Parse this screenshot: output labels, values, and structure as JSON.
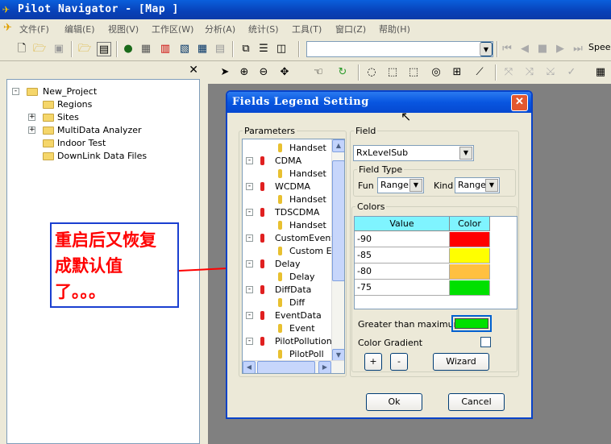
{
  "app": {
    "title": "Pilot Navigator - [Map  ]"
  },
  "menu": [
    "文件(F)",
    "编辑(E)",
    "视图(V)",
    "工作区(W)",
    "分析(A)",
    "统计(S)",
    "工具(T)",
    "窗口(Z)",
    "帮助(H)"
  ],
  "toolbar": {
    "speed_label": "Speed"
  },
  "tree": {
    "items": [
      {
        "label": "New_Project",
        "expander": "-"
      },
      {
        "label": "Regions",
        "expander": ""
      },
      {
        "label": "Sites",
        "expander": "+"
      },
      {
        "label": "MultiData Analyzer",
        "expander": "+"
      },
      {
        "label": "Indoor Test",
        "expander": ""
      },
      {
        "label": "DownLink Data Files",
        "expander": ""
      }
    ]
  },
  "annotation": {
    "line1": "重启后又恢复",
    "line2": "成默认值",
    "line3": "了。。。"
  },
  "dialog": {
    "title": "Fields Legend Setting",
    "parameters_label": "Parameters",
    "params": [
      {
        "label": "Handset",
        "level": 2
      },
      {
        "label": "CDMA",
        "level": 1
      },
      {
        "label": "Handset",
        "level": 2
      },
      {
        "label": "WCDMA",
        "level": 1
      },
      {
        "label": "Handset",
        "level": 2
      },
      {
        "label": "TDSCDMA",
        "level": 1
      },
      {
        "label": "Handset",
        "level": 2
      },
      {
        "label": "CustomEvent",
        "level": 1
      },
      {
        "label": "Custom Ev",
        "level": 2
      },
      {
        "label": "Delay",
        "level": 1
      },
      {
        "label": "Delay",
        "level": 2
      },
      {
        "label": "DiffData",
        "level": 1
      },
      {
        "label": "Diff",
        "level": 2
      },
      {
        "label": "EventData",
        "level": 1
      },
      {
        "label": "Event",
        "level": 2
      },
      {
        "label": "PilotPollution",
        "level": 1
      },
      {
        "label": "PilotPoll",
        "level": 2
      }
    ],
    "field_label": "Field",
    "field_value": "RxLevelSub",
    "field_type_label": "Field Type",
    "fun_label": "Fun",
    "fun_value": "Range",
    "kind_label": "Kind",
    "kind_value": "Range",
    "colors_label": "Colors",
    "table_headers": [
      "Value",
      "Color"
    ],
    "rows": [
      {
        "value": "-90",
        "color": "#ff0000"
      },
      {
        "value": "-85",
        "color": "#ffff00"
      },
      {
        "value": "-80",
        "color": "#ffc040"
      },
      {
        "value": "-75",
        "color": "#00e000"
      }
    ],
    "greater_label": "Greater than maximum:",
    "greater_color": "#00e000",
    "gradient_label": "Color Gradient",
    "plus": "+",
    "minus": "-",
    "wizard": "Wizard",
    "ok": "Ok",
    "cancel": "Cancel"
  }
}
